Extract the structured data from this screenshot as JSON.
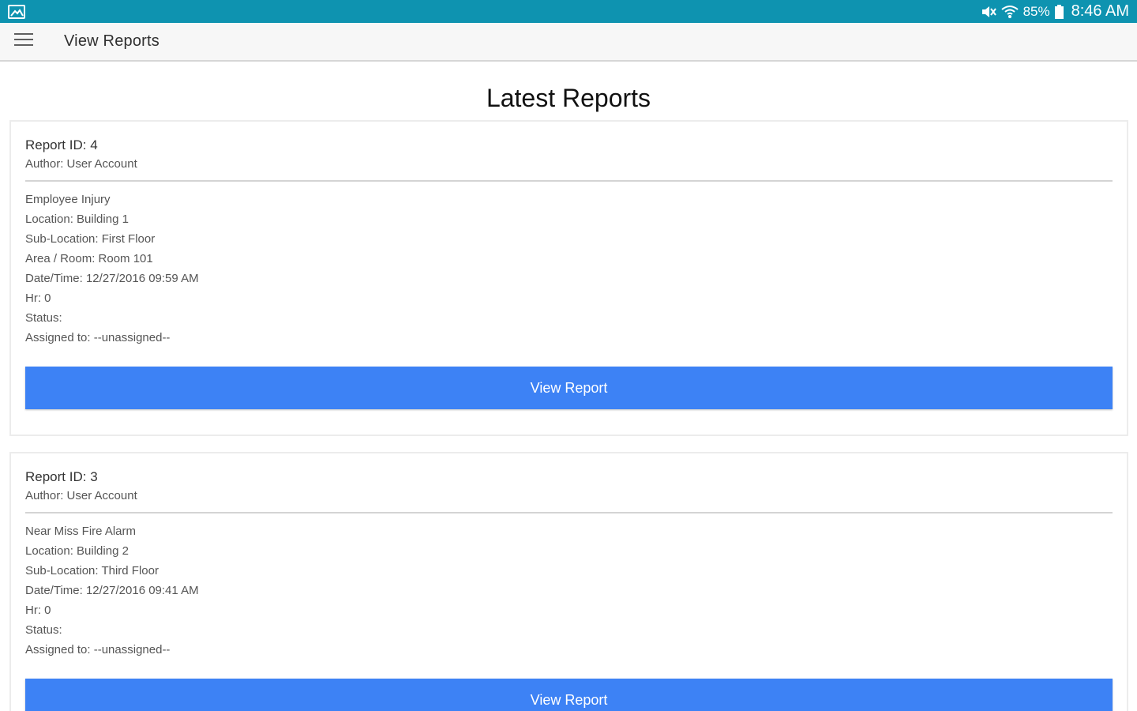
{
  "status_bar": {
    "battery_percent": "85%",
    "time": "8:46 AM",
    "icons": [
      "gallery-icon",
      "mute-icon",
      "wifi-icon",
      "battery-icon"
    ]
  },
  "app_bar": {
    "title": "View Reports",
    "menu_icon": "hamburger-menu-icon"
  },
  "page": {
    "heading": "Latest Reports"
  },
  "reports": [
    {
      "id": "Report ID: 4",
      "author": "Author: User Account",
      "type": "Employee Injury",
      "location": "Location: Building 1",
      "sub_location": "Sub-Location: First Floor",
      "area": "Area / Room: Room 101",
      "datetime": "Date/Time: 12/27/2016 09:59 AM",
      "hr": "Hr: 0",
      "status": "Status:",
      "assigned": "Assigned to: --unassigned--",
      "button_label": "View Report"
    },
    {
      "id": "Report ID: 3",
      "author": "Author: User Account",
      "type": "Near Miss Fire Alarm",
      "location": "Location: Building 2",
      "sub_location": "Sub-Location: Third Floor",
      "datetime": "Date/Time: 12/27/2016 09:41 AM",
      "hr": "Hr: 0",
      "status": "Status:",
      "assigned": "Assigned to: --unassigned--",
      "button_label": "View Report"
    }
  ],
  "colors": {
    "status_bar": "#0e93b0",
    "app_bar": "#f7f7f7",
    "button": "#3d82f5"
  }
}
